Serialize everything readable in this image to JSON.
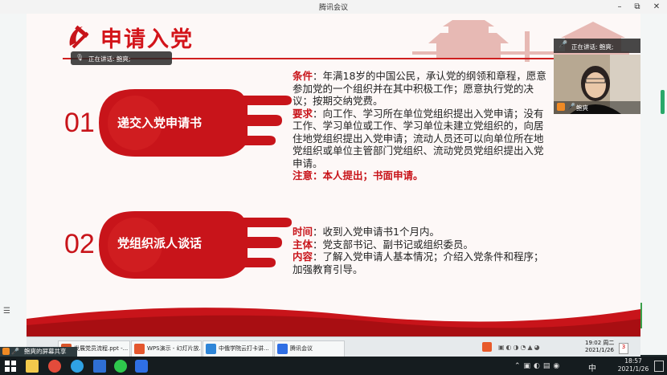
{
  "window": {
    "title": "腾讯会议",
    "min": "–",
    "max": "▫",
    "restore": "⧉",
    "close": "✕"
  },
  "slide": {
    "title": "申请入党",
    "step1": {
      "num": "01",
      "label": "递交入党申请书"
    },
    "step2": {
      "num": "02",
      "label": "党组织派人谈话"
    },
    "s1": {
      "cond_key": "条件",
      "cond_text": "：年满18岁的中国公民，承认党的纲领和章程，愿意参加党的一个组织并在其中积极工作；愿意执行党的决议；按期交纳党费。",
      "req_key": "要求",
      "req_text": "：向工作、学习所在单位党组织提出入党申请；没有工作、学习单位或工作、学习单位未建立党组织的，向居住地党组织提出入党申请；流动人员还可以向单位所在地党组织或单位主管部门党组织、流动党员党组织提出入党申请。",
      "note_key": "注意",
      "note_text": "：本人提出；书面申请。"
    },
    "s2": {
      "time_key": "时间",
      "time_text": "：收到入党申请书1个月内。",
      "subj_key": "主体",
      "subj_text": "：党支部书记、副书记或组织委员。",
      "cont_key": "内容",
      "cont_text": "：了解入党申请人基本情况；介绍入党条件和程序；加强教育引导。"
    }
  },
  "speaking_label": "正在讲话: 鲍爽;",
  "speaking_label2": "正在讲话: 鲍爽;",
  "video_tile_name": "鲍爽",
  "share_label": "鲍爽的屏幕共享",
  "inner_taskbar": {
    "items": [
      {
        "label": "发展党员流程.ppt -..."
      },
      {
        "label": "WPS演示 - 幻灯片放..."
      },
      {
        "label": "中俄学院云打卡讲..."
      },
      {
        "label": "腾讯会议"
      }
    ],
    "time": "19:02 周二",
    "date": "2021/1/26",
    "badge": "3"
  },
  "taskbar": {
    "time": "18:57",
    "date": "2021/1/26",
    "ime": "中"
  },
  "colors": {
    "party_red": "#c8141a",
    "taskbar": "#151c1f"
  }
}
